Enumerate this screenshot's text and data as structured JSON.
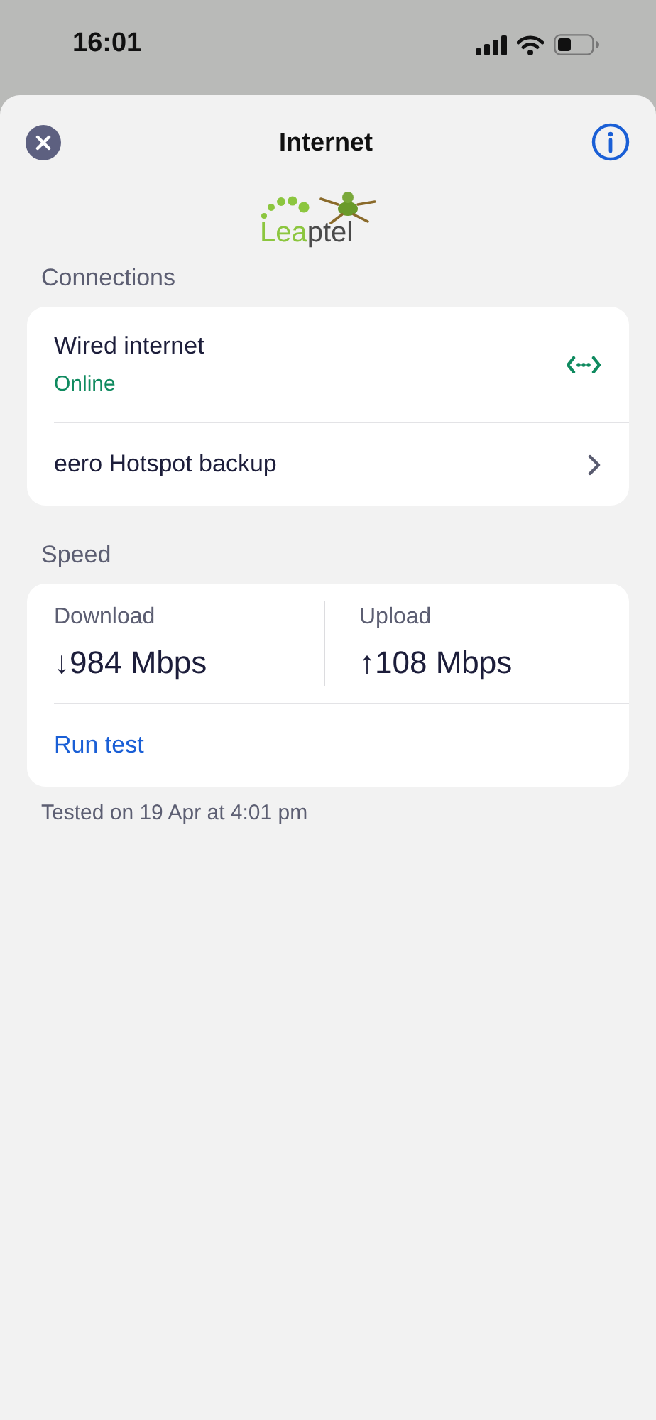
{
  "status_bar": {
    "time": "16:01"
  },
  "header": {
    "title": "Internet"
  },
  "logo": {
    "parts": [
      {
        "text": "Lea",
        "color": "#8cc63f"
      },
      {
        "text": "ptel",
        "color": "#4a4a4a"
      }
    ]
  },
  "connections": {
    "label": "Connections",
    "items": [
      {
        "kind": "status",
        "title": "Wired internet",
        "status": "Online"
      },
      {
        "kind": "link",
        "title": "eero Hotspot backup"
      }
    ]
  },
  "speed": {
    "label": "Speed",
    "metrics": [
      {
        "label": "Download",
        "value": "↓984 Mbps"
      },
      {
        "label": "Upload",
        "value": "↑108 Mbps"
      }
    ],
    "action": "Run test",
    "footnote": "Tested on 19 Apr at 4:01 pm"
  }
}
